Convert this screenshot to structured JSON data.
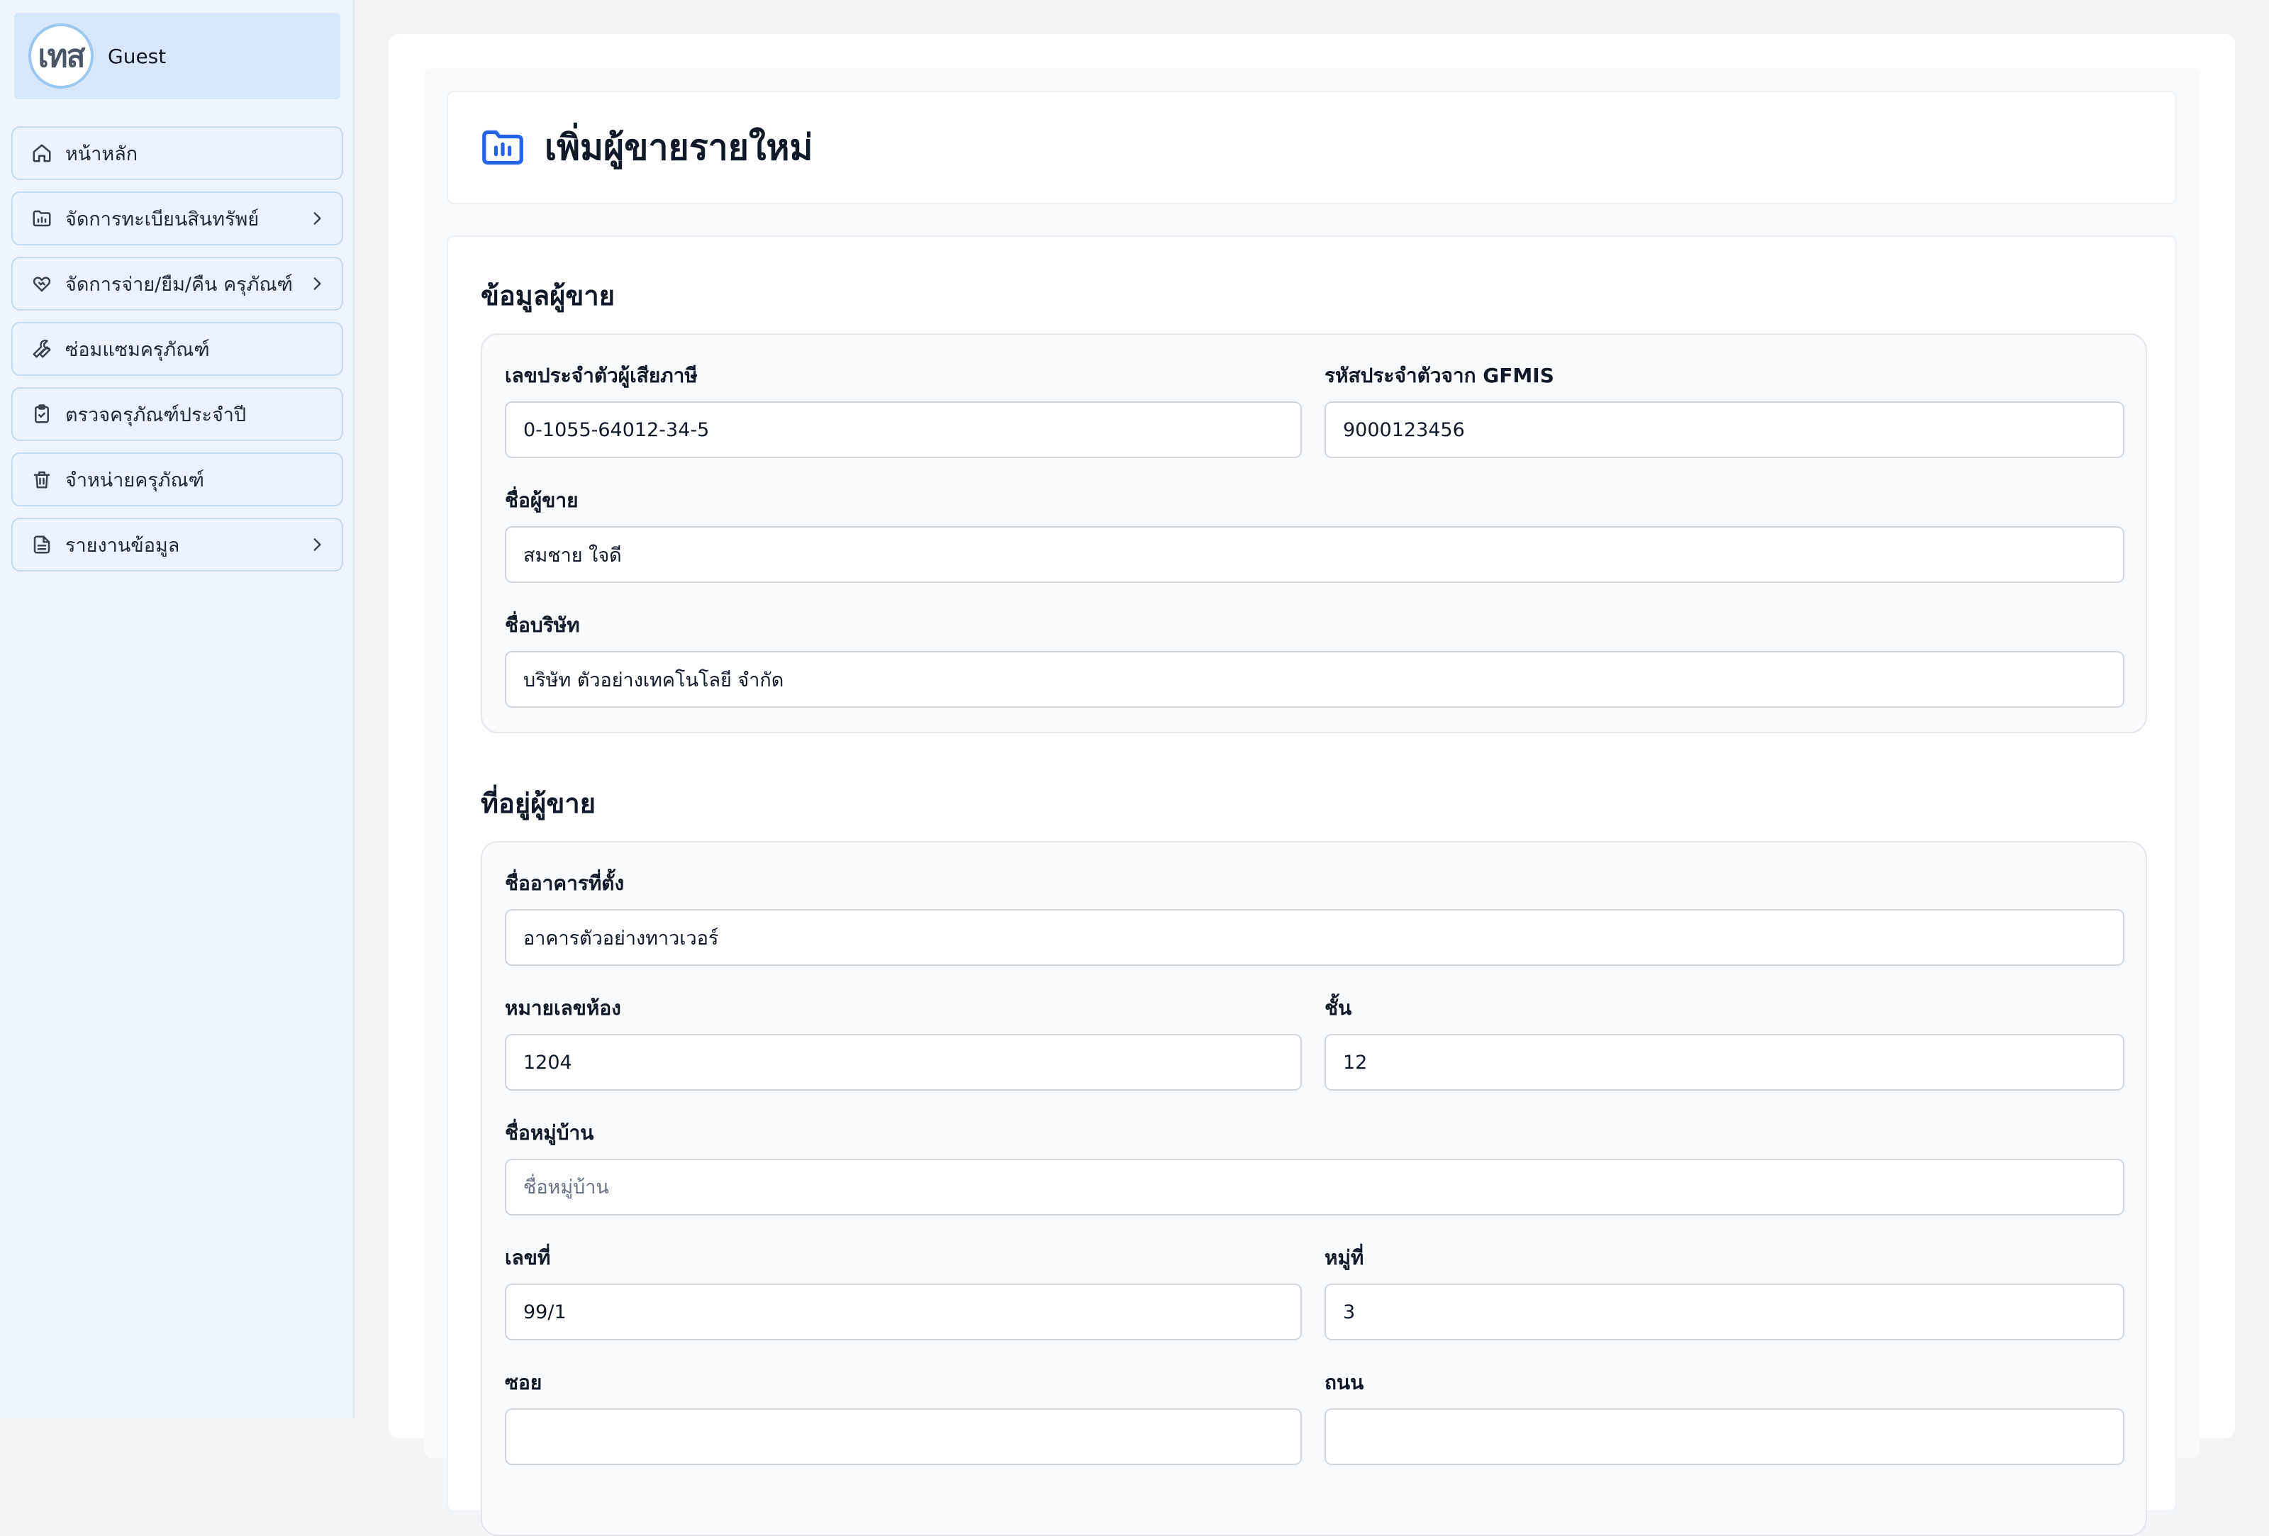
{
  "user": {
    "avatar_text": "เทส",
    "name": "Guest"
  },
  "sidebar": {
    "items": [
      {
        "label": "หน้าหลัก",
        "icon": "home-icon",
        "has_submenu": false
      },
      {
        "label": "จัดการทะเบียนสินทรัพย์",
        "icon": "folder-chart-icon",
        "has_submenu": true
      },
      {
        "label": "จัดการจ่าย/ยืม/คืน ครุภัณฑ์",
        "icon": "handshake-icon",
        "has_submenu": true
      },
      {
        "label": "ซ่อมแซมครุภัณฑ์",
        "icon": "wrench-icon",
        "has_submenu": false
      },
      {
        "label": "ตรวจครุภัณฑ์ประจำปี",
        "icon": "clipboard-check-icon",
        "has_submenu": false
      },
      {
        "label": "จำหน่ายครุภัณฑ์",
        "icon": "trash-icon",
        "has_submenu": false
      },
      {
        "label": "รายงานข้อมูล",
        "icon": "file-text-icon",
        "has_submenu": true
      }
    ]
  },
  "page": {
    "title": "เพิ่มผู้ขายรายใหม่",
    "title_icon": "folder-chart-icon",
    "accent_color": "#2563eb"
  },
  "vendor_info": {
    "section_title": "ข้อมูลผู้ขาย",
    "tax_id": {
      "label": "เลขประจำตัวผู้เสียภาษี",
      "value": "0-1055-64012-34-5",
      "placeholder": ""
    },
    "gfmis_id": {
      "label": "รหัสประจำตัวจาก GFMIS",
      "value": "9000123456",
      "placeholder": ""
    },
    "vendor_name": {
      "label": "ชื่อผู้ขาย",
      "value": "สมชาย ใจดี",
      "placeholder": ""
    },
    "company_name": {
      "label": "ชื่อบริษัท",
      "value": "บริษัท ตัวอย่างเทคโนโลยี จำกัด",
      "placeholder": ""
    }
  },
  "address": {
    "section_title": "ที่อยู่ผู้ขาย",
    "building": {
      "label": "ชื่ออาคารที่ตั้ง",
      "value": "อาคารตัวอย่างทาวเวอร์",
      "placeholder": ""
    },
    "room": {
      "label": "หมายเลขห้อง",
      "value": "1204",
      "placeholder": ""
    },
    "floor": {
      "label": "ชั้น",
      "value": "12",
      "placeholder": ""
    },
    "village": {
      "label": "ชื่อหมู่บ้าน",
      "value": "",
      "placeholder": "ชื่อหมู่บ้าน"
    },
    "house_no": {
      "label": "เลขที่",
      "value": "99/1",
      "placeholder": ""
    },
    "moo": {
      "label": "หมู่ที่",
      "value": "3",
      "placeholder": ""
    },
    "soi": {
      "label": "ซอย",
      "value": "",
      "placeholder": ""
    },
    "road": {
      "label": "ถนน",
      "value": "",
      "placeholder": ""
    }
  }
}
